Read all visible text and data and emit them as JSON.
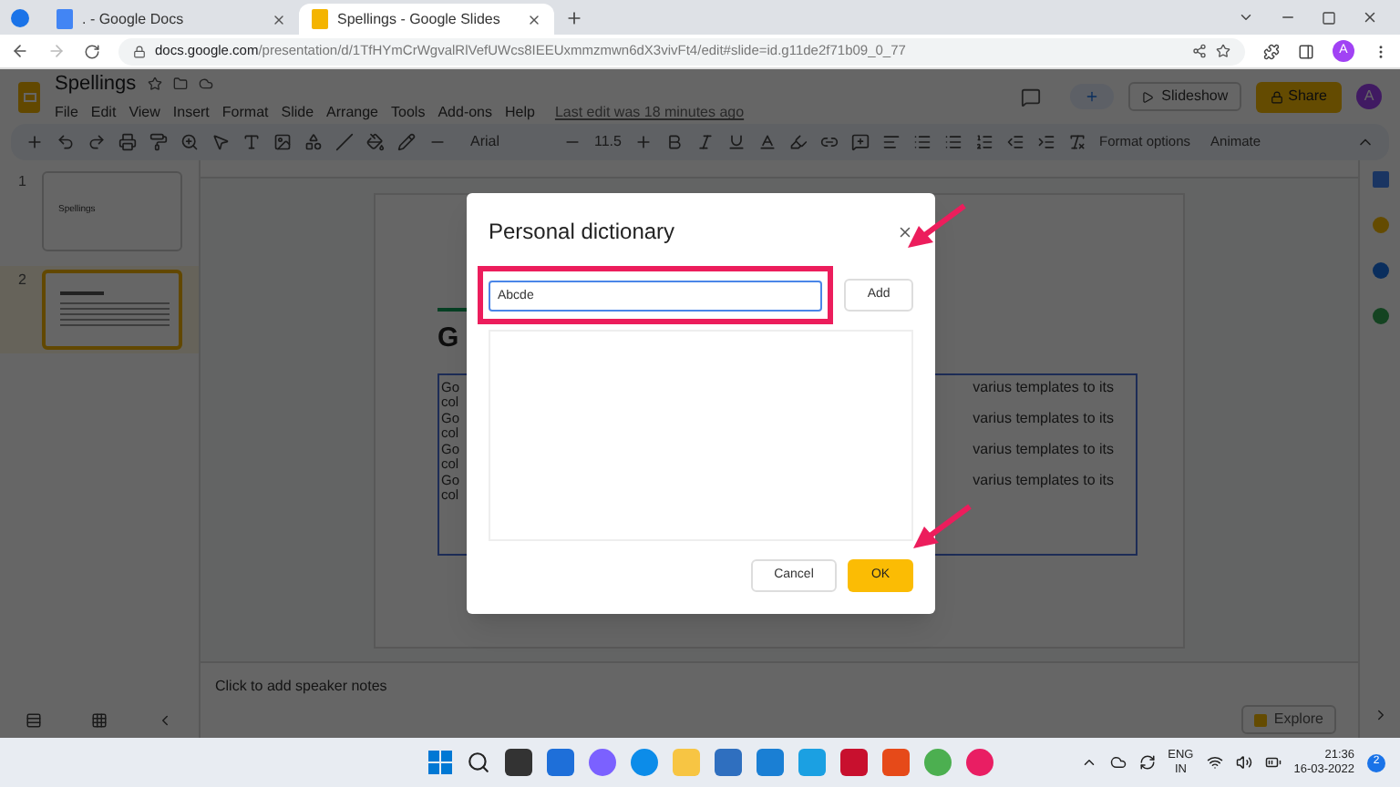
{
  "browser": {
    "tabs": [
      {
        "title": ". - Google Docs",
        "kind": "docs",
        "selected": false
      },
      {
        "title": "Spellings - Google Slides",
        "kind": "slides",
        "selected": true
      }
    ],
    "url_host": "docs.google.com",
    "url_path": "/presentation/d/1TfHYmCrWgvalRlVefUWcs8IEEUxmmzmwn6dX3vivFt4/edit#slide=id.g11de2f71b09_0_77",
    "avatar": "A"
  },
  "app": {
    "title": "Spellings",
    "menu": [
      "File",
      "Edit",
      "View",
      "Insert",
      "Format",
      "Slide",
      "Arrange",
      "Tools",
      "Add-ons",
      "Help"
    ],
    "last_edit": "Last edit was 18 minutes ago",
    "slideshow": "Slideshow",
    "share": "Share",
    "avatar": "A"
  },
  "toolbar": {
    "font": "Arial",
    "font_size": "11.5",
    "format_options": "Format options",
    "animate": "Animate"
  },
  "filmstrip": {
    "slides": [
      {
        "number": "1",
        "title": "Spellings",
        "selected": false
      },
      {
        "number": "2",
        "selected": true
      }
    ]
  },
  "slide": {
    "title": "G",
    "text_left": [
      "Go",
      "col",
      "Go",
      "col",
      "Go",
      "col",
      "Go",
      "col"
    ],
    "text_right": [
      "varius templates to its",
      "varius templates to its",
      "varius templates to its",
      "varius templates to its"
    ]
  },
  "speaker_notes": {
    "placeholder": "Click to add speaker notes"
  },
  "explore": "Explore",
  "dialog": {
    "title": "Personal dictionary",
    "input": {
      "value": "Abcde"
    },
    "add": "Add",
    "cancel": "Cancel",
    "ok": "OK"
  },
  "taskbar": {
    "language": "ENG",
    "region": "IN",
    "time": "21:36",
    "date": "16-03-2022",
    "notifications": "2"
  }
}
